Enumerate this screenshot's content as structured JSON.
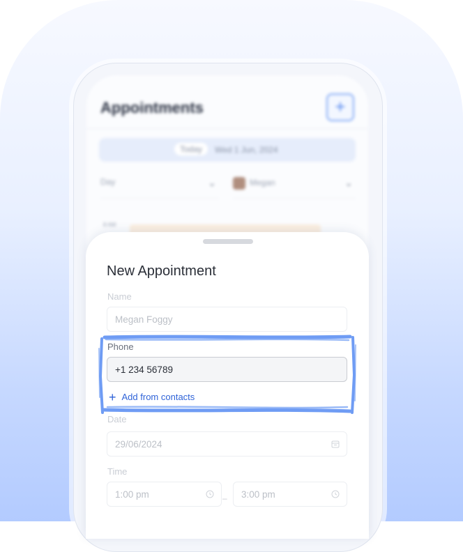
{
  "screen": {
    "title": "Appointments",
    "add_icon": "+",
    "today_label": "Today",
    "date_text": "Wed 1 Jun, 2024",
    "view_select": "Day",
    "staff_select": "Megan",
    "chevron": "⌄",
    "time_label": "8 AM"
  },
  "sheet": {
    "title": "New Appointment",
    "name": {
      "label": "Name",
      "value": "Megan Foggy"
    },
    "phone": {
      "label": "Phone",
      "value": "+1 234 56789"
    },
    "add_from_contacts": "Add from contacts",
    "add_icon": "+",
    "date": {
      "label": "Date",
      "value": "29/06/2024",
      "icon": "calendar-icon"
    },
    "time": {
      "label": "Time",
      "start": "1:00 pm",
      "end": "3:00 pm",
      "separator": "–",
      "icon": "clock-icon"
    }
  },
  "colors": {
    "accent": "#2f63d8",
    "highlight": "#6f9cf4",
    "background": "#c6d8ff"
  }
}
